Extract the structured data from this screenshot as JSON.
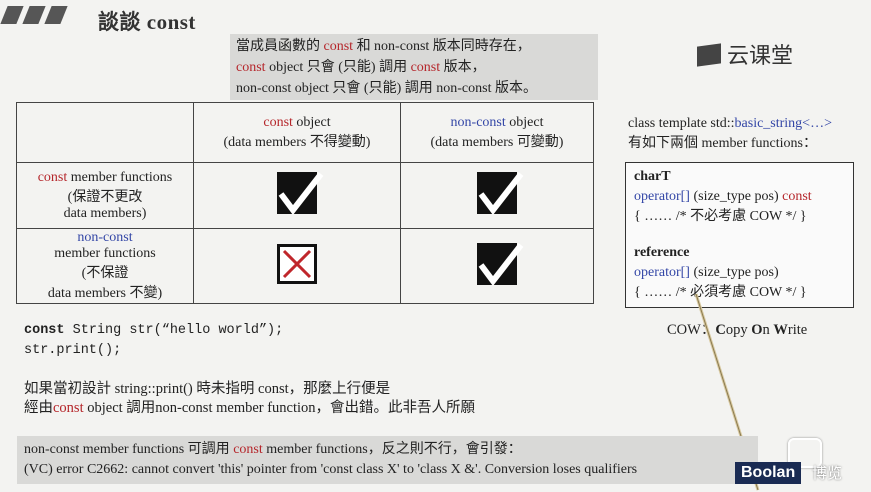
{
  "slide": {
    "title": "談談 const",
    "logo": "云课堂"
  },
  "note": {
    "line1_pre": "當成員函數的 ",
    "line1_red": "const",
    "line1_post": " 和 non-const 版本同時存在，",
    "line2_red1": "const",
    "line2_mid": " object 只會 (只能) 調用 ",
    "line2_red2": "const",
    "line2_post": " 版本，",
    "line3": "non-const object 只會 (只能) 調用 non-const 版本。"
  },
  "matrix": {
    "col1_red": "const",
    "col1_rest": " object",
    "col1_sub": "(data members 不得變動)",
    "col2_blue": "non-const",
    "col2_rest": " object",
    "col2_sub": "(data members 可變動)",
    "row1_red": "const",
    "row1_rest": " member functions",
    "row1_l2": "(保證不更改",
    "row1_l3": "data members)",
    "row2_blue": "non-const",
    "row2_l2": "member functions",
    "row2_l3": "(不保證",
    "row2_l4": "data members 不變)",
    "cells": [
      "check-icon",
      "check-icon",
      "cross-icon",
      "check-icon"
    ]
  },
  "code": {
    "kw": "const",
    "line1_rest": " String str(“hello world”);",
    "line2": "str.print();"
  },
  "explain": {
    "line1": "如果當初設計 string::print() 時未指明 const，那麼上行便是",
    "line2_pre": "經由",
    "line2_red": "const",
    "line2_post": " object 調用non-const member function，會出錯。此非吾人所願"
  },
  "right": {
    "head1_pre": "class template std::",
    "head1_blue": "basic_string<…>",
    "head2": "有如下兩個 member functions：",
    "b1_title": "charT",
    "b1_op": "operator[]",
    "b1_args": " (size_type pos) ",
    "b1_const": "const",
    "b1_body": "{ …… /* 不必考慮 COW */ }",
    "b2_title": "reference",
    "b2_op": "operator[]",
    "b2_args": " (size_type pos)",
    "b2_body": "{ …… /* 必須考慮 COW */ }",
    "cow_pre": "COW：",
    "cow_c": "C",
    "cow_opy": "opy ",
    "cow_o": "O",
    "cow_n": "n ",
    "cow_w": "W",
    "cow_rite": "rite"
  },
  "bottom": {
    "line1_pre": "non-const member functions 可調用 ",
    "line1_red": "const",
    "line1_post": " member functions，反之則不行，會引發：",
    "line2": "(VC) error C2662: cannot convert 'this' pointer from 'const class X' to 'class X &'.  Conversion loses qualifiers"
  },
  "watermark": {
    "boolan": "Boolan",
    "bili": "博览"
  }
}
